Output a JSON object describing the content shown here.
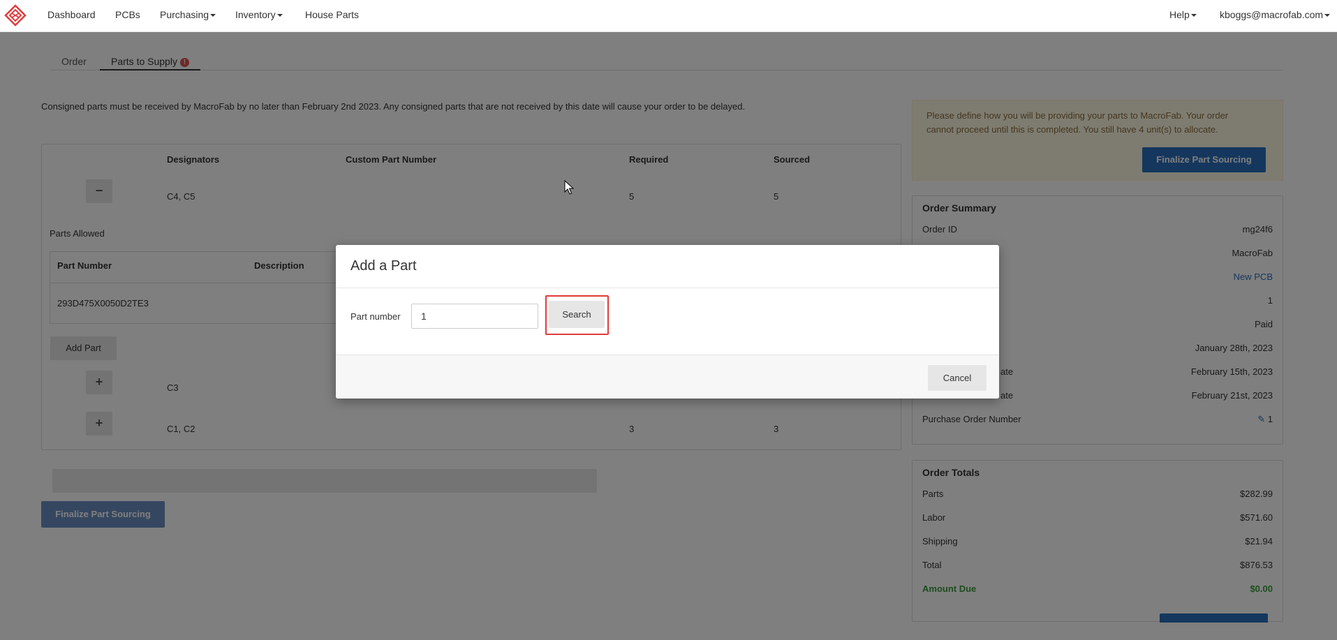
{
  "navbar": {
    "items": [
      {
        "label": "Dashboard"
      },
      {
        "label": "PCBs"
      },
      {
        "label": "Purchasing"
      },
      {
        "label": "Inventory"
      },
      {
        "label": "House Parts"
      }
    ],
    "help_label": "Help",
    "user_label": "kboggs@macrofab.com",
    "brand_color": "#e03c3c"
  },
  "tabs": [
    {
      "label": "Order",
      "active": false
    },
    {
      "label": "Parts to Supply",
      "active": true,
      "badge": "!"
    }
  ],
  "notice": "Consigned parts must be received by MacroFab by no later than February 2nd 2023.  Any consigned parts that are not received by this date will cause your order to be delayed.",
  "parts_table": {
    "headers": {
      "designators": "Designators",
      "custom_part_number": "Custom Part Number",
      "required": "Required",
      "sourced": "Sourced"
    },
    "rows": [
      {
        "toggle": "−",
        "designators": "C4, C5",
        "required": "5",
        "sourced": "5"
      },
      {
        "toggle": "+",
        "designators": "C3",
        "required": "",
        "sourced": ""
      },
      {
        "toggle": "+",
        "designators": "C1, C2",
        "required": "3",
        "sourced": "3"
      }
    ],
    "parts_allowed_label": "Parts Allowed",
    "sub_headers": {
      "part_number": "Part Number",
      "description": "Description"
    },
    "sub_row": {
      "part_number": "293D475X0050D2TE3"
    },
    "add_part_label": "Add Part"
  },
  "finalize_left_label": "Finalize Part Sourcing",
  "sourcing_info": {
    "text": "Please define how you will be providing your parts to MacroFab. Your order cannot proceed until this is completed. You still have 4 unit(s) to allocate.",
    "button_label": "Finalize Part Sourcing"
  },
  "order_summary": {
    "title": "Order Summary",
    "rows": [
      {
        "label": "Order ID",
        "value": "mg24f6"
      },
      {
        "label": "",
        "value": "MacroFab"
      },
      {
        "label": "",
        "value": "New PCB"
      },
      {
        "label": "",
        "value": "1"
      },
      {
        "label": "",
        "value": "Paid"
      },
      {
        "label": "",
        "value": "January 28th, 2023"
      },
      {
        "label": "ate",
        "value": "February 15th, 2023"
      },
      {
        "label": "ate",
        "value": "February 21st, 2023"
      },
      {
        "label": "Purchase Order Number",
        "value": "1"
      }
    ]
  },
  "order_totals": {
    "title": "Order Totals",
    "rows": [
      {
        "label": "Parts",
        "value": "$282.99"
      },
      {
        "label": "Labor",
        "value": "$571.60"
      },
      {
        "label": "Shipping",
        "value": "$21.94"
      },
      {
        "label": "Total",
        "value": "$876.53"
      }
    ],
    "amount_due": {
      "label": "Amount Due",
      "value": "$0.00"
    }
  },
  "modal": {
    "title": "Add a Part",
    "part_number_label": "Part number",
    "part_number_value": "1",
    "search_label": "Search",
    "cancel_label": "Cancel"
  }
}
